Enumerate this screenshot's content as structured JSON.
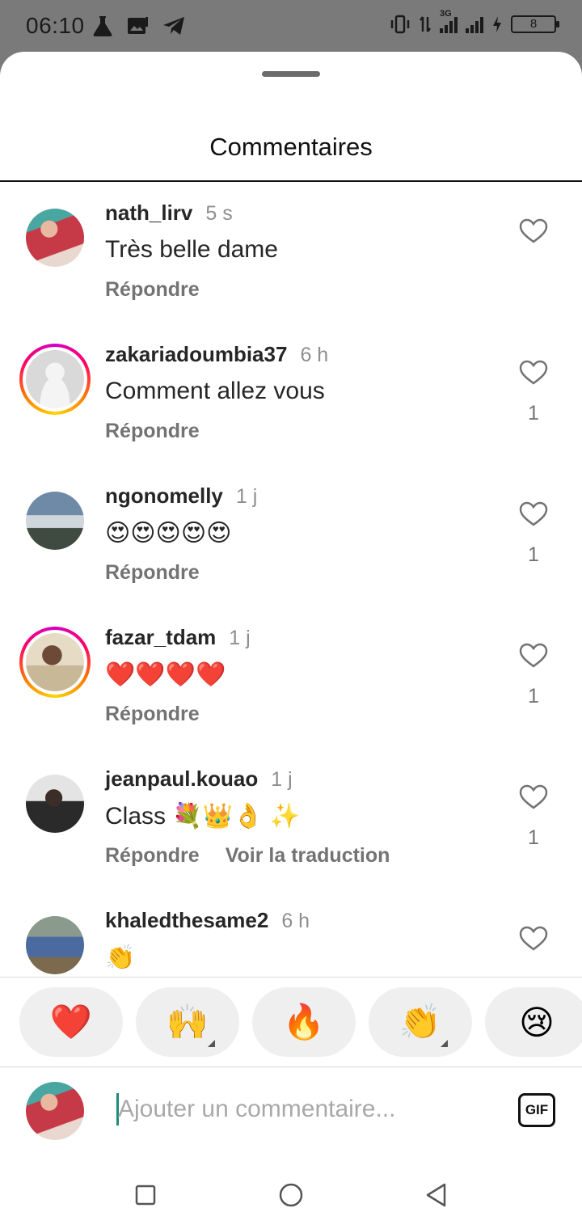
{
  "status": {
    "time": "06:10",
    "network": "3G",
    "battery": "8"
  },
  "sheet": {
    "title": "Commentaires"
  },
  "comments": [
    {
      "user": "nath_lirv",
      "time": "5 s",
      "text": "Très belle dame",
      "reply": "Répondre",
      "likes": "",
      "avatar_story_ring": false
    },
    {
      "user": "zakariadoumbia37",
      "time": "6 h",
      "text": "Comment allez vous",
      "reply": "Répondre",
      "likes": "1",
      "avatar_story_ring": true
    },
    {
      "user": "ngonomelly",
      "time": "1 j",
      "text": "😍😍😍😍😍",
      "reply": "Répondre",
      "likes": "1",
      "avatar_story_ring": false
    },
    {
      "user": "fazar_tdam",
      "time": "1 j",
      "text": "❤️❤️❤️❤️",
      "reply": "Répondre",
      "likes": "1",
      "avatar_story_ring": true
    },
    {
      "user": "jeanpaul.kouao",
      "time": "1 j",
      "text": "Class 💐👑👌 ✨",
      "reply": "Répondre",
      "translate": "Voir la traduction",
      "likes": "1",
      "avatar_story_ring": false
    },
    {
      "user": "khaledthesame2",
      "time": "6 h",
      "text": "👏",
      "reply": "",
      "likes": "",
      "avatar_story_ring": false
    }
  ],
  "reactions": [
    "❤️",
    "🙌",
    "🔥",
    "👏",
    "😢"
  ],
  "composer": {
    "placeholder": "Ajouter un commentaire...",
    "gif_label": "GIF"
  },
  "icons": {
    "like": "heart-outline-icon",
    "nav": [
      "recent-apps-icon",
      "home-icon",
      "back-icon"
    ]
  },
  "colors": {
    "story_ring": "#ff0069",
    "cursor": "#1f8a78"
  }
}
